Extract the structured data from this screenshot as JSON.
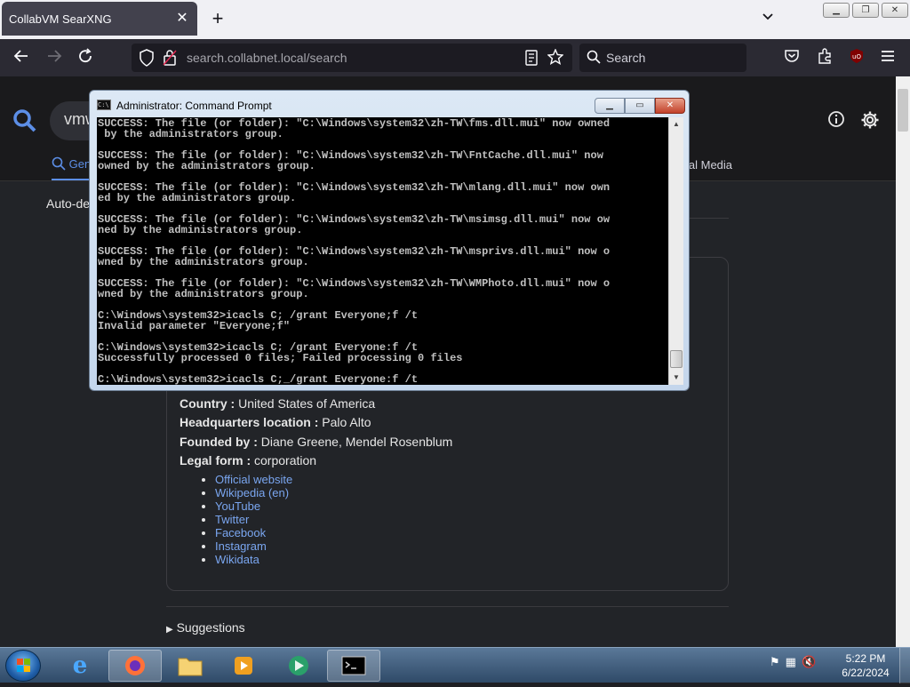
{
  "browser": {
    "tab_title": "CollabVM SearXNG",
    "tab_close": "✕",
    "new_tab": "+",
    "url_host": "search.collabnet.local",
    "url_path": "/search",
    "search_placeholder": "Search"
  },
  "page": {
    "query_fragment": "vmw",
    "category_general": "Gen",
    "category_social": "ial Media",
    "autodetect": "Auto-det",
    "suggestions": "Suggestions",
    "infobox": {
      "rows": [
        {
          "label": "Country :",
          "value": "United States of America"
        },
        {
          "label": "Headquarters location :",
          "value": "Palo Alto"
        },
        {
          "label": "Founded by :",
          "value": "Diane Greene, Mendel Rosenblum"
        },
        {
          "label": "Legal form :",
          "value": "corporation"
        }
      ],
      "links": [
        "Official website",
        "Wikipedia (en)",
        "YouTube",
        "Twitter",
        "Facebook",
        "Instagram",
        "Wikidata"
      ]
    }
  },
  "cmd": {
    "title": "Administrator: Command Prompt",
    "lines": [
      "SUCCESS: The file (or folder): \"C:\\Windows\\system32\\zh-TW\\fms.dll.mui\" now owned",
      " by the administrators group.",
      "",
      "SUCCESS: The file (or folder): \"C:\\Windows\\system32\\zh-TW\\FntCache.dll.mui\" now",
      "owned by the administrators group.",
      "",
      "SUCCESS: The file (or folder): \"C:\\Windows\\system32\\zh-TW\\mlang.dll.mui\" now own",
      "ed by the administrators group.",
      "",
      "SUCCESS: The file (or folder): \"C:\\Windows\\system32\\zh-TW\\msimsg.dll.mui\" now ow",
      "ned by the administrators group.",
      "",
      "SUCCESS: The file (or folder): \"C:\\Windows\\system32\\zh-TW\\msprivs.dll.mui\" now o",
      "wned by the administrators group.",
      "",
      "SUCCESS: The file (or folder): \"C:\\Windows\\system32\\zh-TW\\WMPhoto.dll.mui\" now o",
      "wned by the administrators group.",
      "",
      "C:\\Windows\\system32>icacls C; /grant Everyone;f /t",
      "Invalid parameter \"Everyone;f\"",
      "",
      "C:\\Windows\\system32>icacls C; /grant Everyone:f /t",
      "Successfully processed 0 files; Failed processing 0 files",
      "",
      "C:\\Windows\\system32>icacls C;_/grant Everyone:f /t"
    ]
  },
  "taskbar": {
    "time": "5:22 PM",
    "date": "6/22/2024"
  }
}
